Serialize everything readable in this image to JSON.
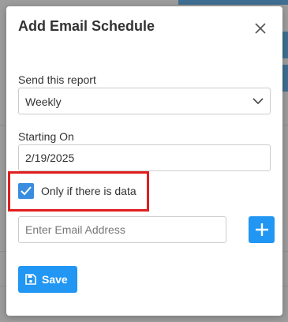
{
  "modal": {
    "title": "Add Email Schedule"
  },
  "send_report": {
    "label": "Send this report",
    "selected": "Weekly"
  },
  "starting_on": {
    "label": "Starting On",
    "value": "2/19/2025"
  },
  "data_condition": {
    "label": "Only if there is data",
    "checked": true
  },
  "email": {
    "placeholder": "Enter Email Address",
    "value": ""
  },
  "actions": {
    "save_label": "Save"
  },
  "colors": {
    "primary": "#2196f3",
    "checkbox": "#3a8dde",
    "highlight": "#e01e1e"
  },
  "icons": {
    "close": "close-icon",
    "chevron": "chevron-down-icon",
    "check": "check-icon",
    "add": "plus-icon",
    "save": "floppy-disk-icon"
  }
}
